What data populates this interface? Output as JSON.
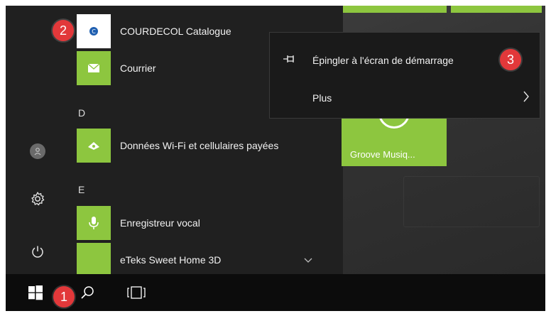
{
  "start_menu": {
    "apps": [
      {
        "name": "COURDECOL Catalogue",
        "icon": "courdecol-logo-icon"
      },
      {
        "name": "Courrier",
        "icon": "mail-icon"
      },
      {
        "name": "Données Wi-Fi et cellulaires payées",
        "icon": "wifi-data-icon"
      },
      {
        "name": "Enregistreur vocal",
        "icon": "microphone-icon"
      },
      {
        "name": "eTeks Sweet Home 3D",
        "icon": "sweet-home-3d-icon"
      }
    ],
    "section_letters": [
      "D",
      "E"
    ],
    "expand_icon": "chevron-down-icon"
  },
  "tiles": {
    "groove_label": "Groove Musiq..."
  },
  "context_menu": {
    "pin_label": "Épingler à l'écran de démarrage",
    "more_label": "Plus"
  },
  "annotations": {
    "step1": "1",
    "step2": "2",
    "step3": "3"
  },
  "colors": {
    "tile_green": "#8dc63f",
    "badge_red": "#e2383a",
    "menu_bg": "#202020",
    "taskbar_bg": "#0c0c0c"
  }
}
